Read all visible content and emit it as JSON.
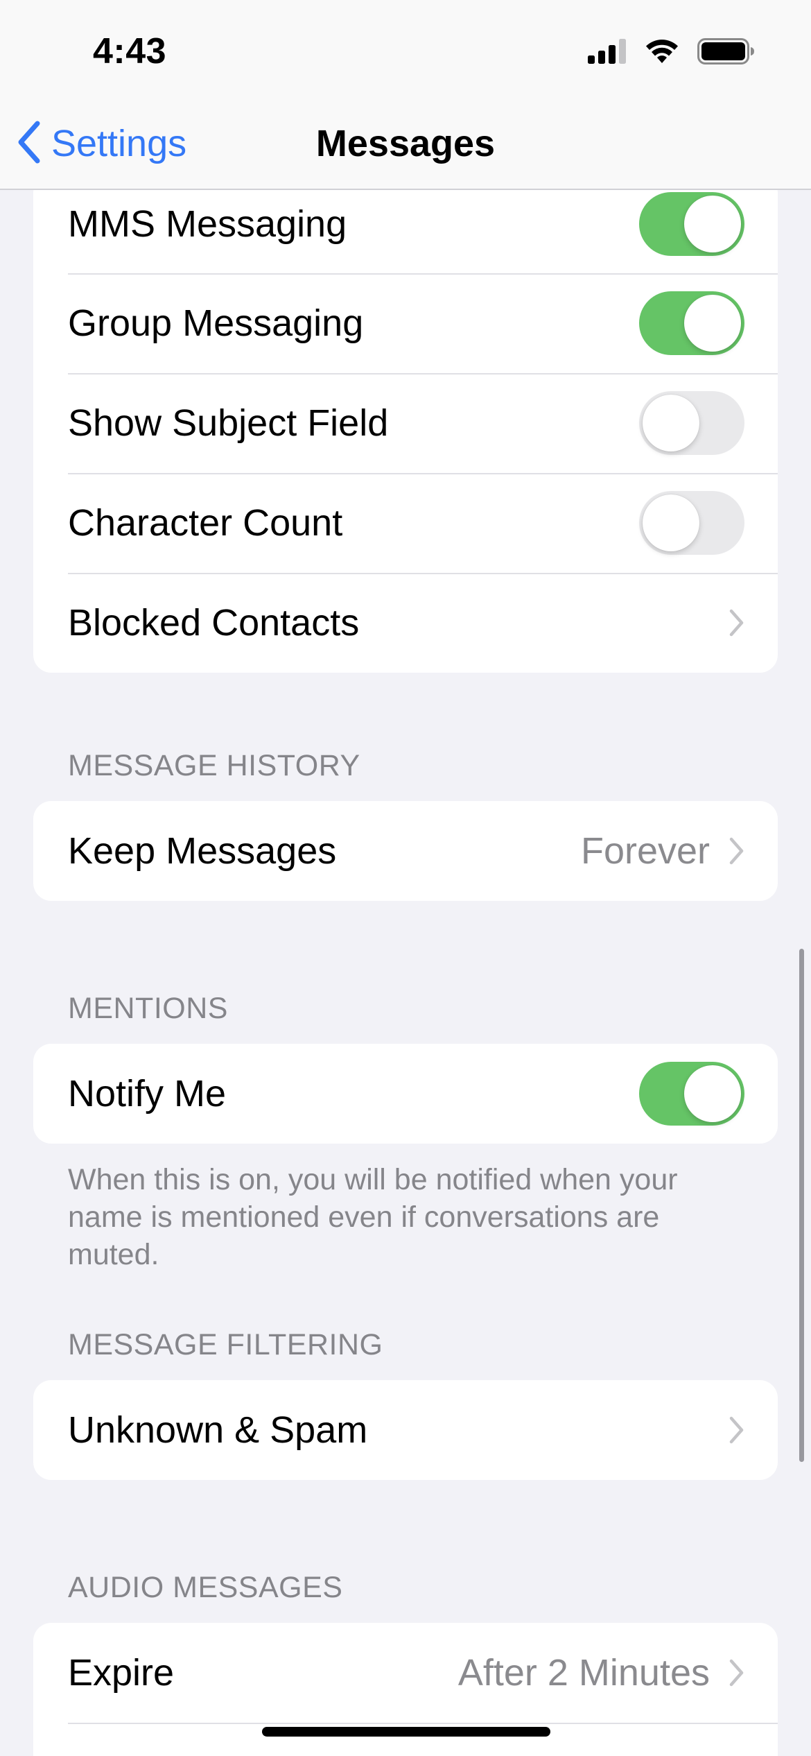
{
  "status_bar": {
    "time": "4:43",
    "icons": [
      "cellular-signal-icon",
      "wifi-icon",
      "battery-icon"
    ]
  },
  "nav": {
    "back_label": "Settings",
    "title": "Messages"
  },
  "groups": {
    "sms": {
      "rows": [
        {
          "label": "MMS Messaging",
          "control": "toggle",
          "on": true
        },
        {
          "label": "Group Messaging",
          "control": "toggle",
          "on": true
        },
        {
          "label": "Show Subject Field",
          "control": "toggle",
          "on": false
        },
        {
          "label": "Character Count",
          "control": "toggle",
          "on": false
        },
        {
          "label": "Blocked Contacts",
          "control": "chevron"
        }
      ]
    },
    "history": {
      "header": "MESSAGE HISTORY",
      "rows": [
        {
          "label": "Keep Messages",
          "value": "Forever",
          "control": "chevron"
        }
      ]
    },
    "mentions": {
      "header": "MENTIONS",
      "rows": [
        {
          "label": "Notify Me",
          "control": "toggle",
          "on": true
        }
      ],
      "footer": "When this is on, you will be notified when your name is mentioned even if conversations are muted."
    },
    "filtering": {
      "header": "MESSAGE FILTERING",
      "rows": [
        {
          "label": "Unknown & Spam",
          "control": "chevron"
        }
      ]
    },
    "audio": {
      "header": "AUDIO MESSAGES",
      "rows": [
        {
          "label": "Expire",
          "value": "After 2 Minutes",
          "control": "chevron"
        },
        {
          "label": "",
          "control": "toggle",
          "on": true
        }
      ]
    }
  },
  "colors": {
    "accent": "#3478F6",
    "toggle_on": "#65C466",
    "toggle_off": "#E9E9EB",
    "background": "#F2F2F7",
    "secondary_text": "#85858A"
  }
}
